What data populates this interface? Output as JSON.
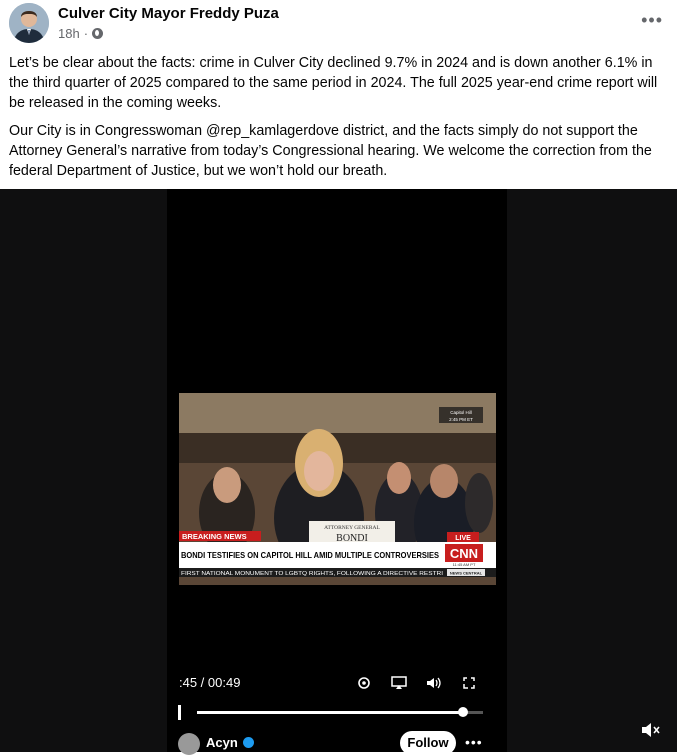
{
  "post": {
    "author": "Culver City Mayor Freddy Puza",
    "time": "18h",
    "paragraphs": [
      "Let’s be clear about the facts: crime in Culver City declined 9.7% in 2024 and is down another 6.1% in the third quarter of 2025 compared to the same period in 2024. The full 2025 year-end crime report will be released in the coming weeks.",
      "Our City is in Congresswoman @rep_kamlagerdove district, and the facts simply do not support the Attorney General’s narrative from today’s Congressional hearing. We welcome the correction from the federal Department of Justice, but we won’t hold our breath."
    ],
    "more_icon": "more-horizontal-icon",
    "privacy_icon": "globe-icon"
  },
  "video": {
    "timestamp_label": ":45 / 00:49",
    "progress": 0.93,
    "broadcast": {
      "location": "Capitol Hill",
      "time": "2:45 PM ET",
      "breaking": "BREAKING NEWS",
      "headline": "BONDI TESTIFIES ON CAPITOL HILL AMID MULTIPLE CONTROVERSIES",
      "ticker": "FIRST NATIONAL MONUMENT TO LGBTQ RIGHTS, FOLLOWING A DIRECTIVE RESTRI",
      "ticker_tag": "NEWS CENTRAL",
      "nameplate_title": "ATTORNEY GENERAL",
      "nameplate_name": "BONDI",
      "live": "LIVE",
      "network": "CNN",
      "network_time": "11:45 AM PT"
    },
    "account": "Acyn",
    "follow_label": "Follow"
  }
}
